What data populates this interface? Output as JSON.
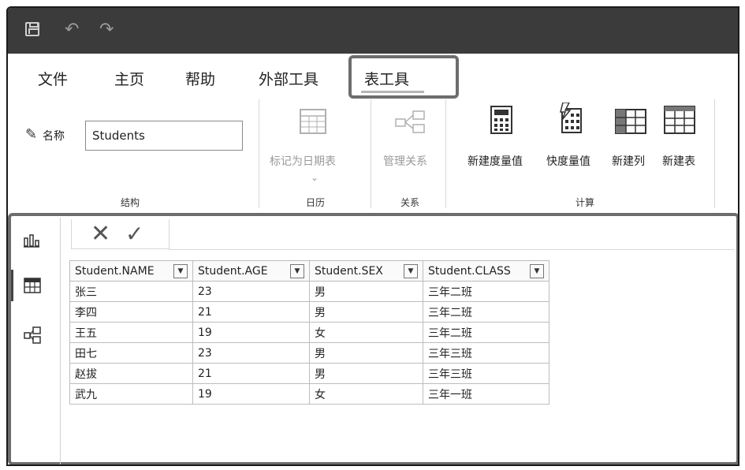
{
  "menu": {
    "items": [
      "文件",
      "主页",
      "帮助",
      "外部工具",
      "表工具"
    ]
  },
  "ribbon": {
    "name_label": "名称",
    "name_value": "Students",
    "groups": {
      "structure": "结构",
      "calendar": "日历",
      "relations": "关系",
      "calc": "计算"
    },
    "buttons": {
      "mark_date": "标记为日期表",
      "manage_rel": "管理关系",
      "new_measure": "新建度量值",
      "quick_measure": "快度量值",
      "new_column": "新建列",
      "new_table": "新建表"
    }
  },
  "table": {
    "columns": [
      "Student.NAME",
      "Student.AGE",
      "Student.SEX",
      "Student.CLASS"
    ],
    "rows": [
      [
        "张三",
        "23",
        "男",
        "三年二班"
      ],
      [
        "李四",
        "21",
        "男",
        "三年二班"
      ],
      [
        "王五",
        "19",
        "女",
        "三年二班"
      ],
      [
        "田七",
        "23",
        "男",
        "三年三班"
      ],
      [
        "赵拔",
        "21",
        "男",
        "三年三班"
      ],
      [
        "武九",
        "19",
        "女",
        "三年一班"
      ]
    ]
  },
  "colors": {
    "titlebar": "#3b3b3b",
    "highlight_border": "#6d6d6d"
  }
}
